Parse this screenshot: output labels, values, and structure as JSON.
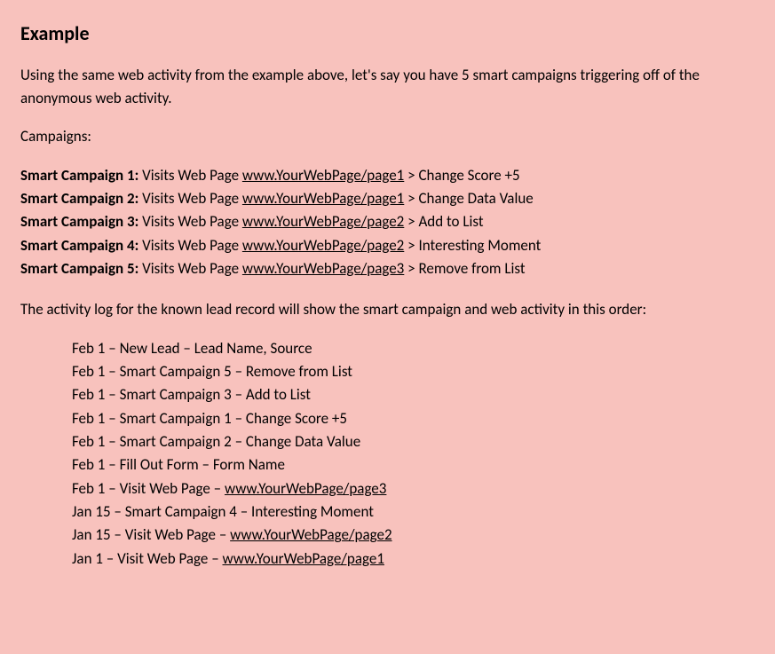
{
  "heading": "Example",
  "intro": "Using the same web activity from the example above, let's say you have 5 smart campaigns triggering off of the anonymous web activity.",
  "campaigns_label": "Campaigns:",
  "campaigns": [
    {
      "name": "Smart Campaign 1:",
      "trigger_pre": " Visits Web Page ",
      "link": "www.YourWebPage/page1",
      "arrow": "  >  ",
      "action": "Change Score +5"
    },
    {
      "name": "Smart Campaign 2:",
      "trigger_pre": " Visits Web Page ",
      "link": "www.YourWebPage/page1",
      "arrow": "  >  ",
      "action": "Change Data Value"
    },
    {
      "name": "Smart Campaign 3:",
      "trigger_pre": " Visits Web Page ",
      "link": "www.YourWebPage/page2",
      "arrow": "  >  ",
      "action": "Add to List"
    },
    {
      "name": "Smart Campaign 4:",
      "trigger_pre": " Visits Web Page ",
      "link": "www.YourWebPage/page2",
      "arrow": "  >  ",
      "action": "Interesting Moment"
    },
    {
      "name": "Smart Campaign 5:",
      "trigger_pre": " Visits Web Page ",
      "link": "www.YourWebPage/page3",
      "arrow": "  >  ",
      "action": "Remove from List"
    }
  ],
  "log_intro": "The activity log for the known lead record will show the smart campaign and web activity in this order:",
  "log": [
    {
      "text_pre": "Feb 1 – New Lead – Lead Name, Source",
      "link": ""
    },
    {
      "text_pre": "Feb 1 – Smart Campaign 5 – Remove from List",
      "link": ""
    },
    {
      "text_pre": "Feb 1 – Smart Campaign 3 – Add to List",
      "link": ""
    },
    {
      "text_pre": "Feb 1 – Smart Campaign 1 – Change Score +5",
      "link": ""
    },
    {
      "text_pre": "Feb 1 – Smart Campaign 2 – Change Data Value",
      "link": ""
    },
    {
      "text_pre": "Feb 1 – Fill Out Form – Form Name",
      "link": ""
    },
    {
      "text_pre": "Feb 1 – Visit Web Page – ",
      "link": "www.YourWebPage/page3"
    },
    {
      "text_pre": "Jan 15 – Smart Campaign 4 – Interesting Moment",
      "link": ""
    },
    {
      "text_pre": "Jan 15 – Visit Web Page – ",
      "link": "www.YourWebPage/page2"
    },
    {
      "text_pre": "Jan 1 – Visit Web Page – ",
      "link": "www.YourWebPage/page1"
    }
  ]
}
